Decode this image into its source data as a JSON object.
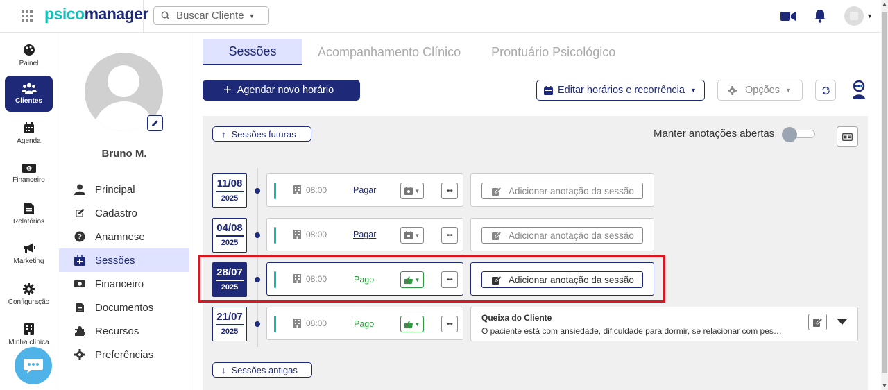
{
  "header": {
    "logo_part1": "psico",
    "logo_part2": "manager",
    "search_placeholder": "Buscar Cliente"
  },
  "left_nav": {
    "items": [
      {
        "label": "Painel",
        "icon": "palette-icon"
      },
      {
        "label": "Clientes",
        "icon": "users-icon",
        "active": true
      },
      {
        "label": "Agenda",
        "icon": "calendar-icon"
      },
      {
        "label": "Financeiro",
        "icon": "money-icon"
      },
      {
        "label": "Relatórios",
        "icon": "file-icon"
      },
      {
        "label": "Marketing",
        "icon": "megaphone-icon"
      },
      {
        "label": "Configuração",
        "icon": "gear-icon"
      },
      {
        "label": "Minha clínica",
        "icon": "building-icon"
      }
    ]
  },
  "profile": {
    "name": "Bruno M.",
    "menu": [
      {
        "label": "Principal",
        "icon": "user-icon"
      },
      {
        "label": "Cadastro",
        "icon": "edit-icon"
      },
      {
        "label": "Anamnese",
        "icon": "question-icon"
      },
      {
        "label": "Sessões",
        "icon": "medical-icon",
        "active": true
      },
      {
        "label": "Financeiro",
        "icon": "money-icon"
      },
      {
        "label": "Documentos",
        "icon": "file-icon"
      },
      {
        "label": "Recursos",
        "icon": "puzzle-icon"
      },
      {
        "label": "Preferências",
        "icon": "gear-icon"
      }
    ]
  },
  "tabs": [
    {
      "label": "Sessões",
      "active": true
    },
    {
      "label": "Acompanhamento Clínico"
    },
    {
      "label": "Prontuário Psicológico"
    }
  ],
  "toolbar": {
    "new_schedule": "Agendar novo horário",
    "edit_schedule": "Editar horários e recorrência",
    "options": "Opções"
  },
  "panel": {
    "future_sessions": "Sessões futuras",
    "keep_notes_open": "Manter anotações abertas",
    "old_sessions": "Sessões antigas"
  },
  "sessions": [
    {
      "day": "11/08",
      "year": "2025",
      "time": "08:00",
      "payment": "Pagar",
      "paid": false,
      "note_button": "Adicionar anotação da sessão"
    },
    {
      "day": "04/08",
      "year": "2025",
      "time": "08:00",
      "payment": "Pagar",
      "paid": false,
      "note_button": "Adicionar anotação da sessão"
    },
    {
      "day": "28/07",
      "year": "2025",
      "time": "08:00",
      "payment": "Pago",
      "paid": true,
      "selected": true,
      "note_button": "Adicionar anotação da sessão"
    },
    {
      "day": "21/07",
      "year": "2025",
      "time": "08:00",
      "payment": "Pago",
      "paid": true,
      "note_title": "Queixa do Cliente",
      "note_text": "O paciente está com ansiedade, dificuldade para dormir, se relacionar com pes…"
    }
  ],
  "colors": {
    "brand_navy": "#1e2a78",
    "brand_teal": "#14c0b8",
    "paid_green": "#2e9a3e",
    "highlight_red": "#e0141e",
    "active_tab_bg": "#dfe3ff"
  }
}
